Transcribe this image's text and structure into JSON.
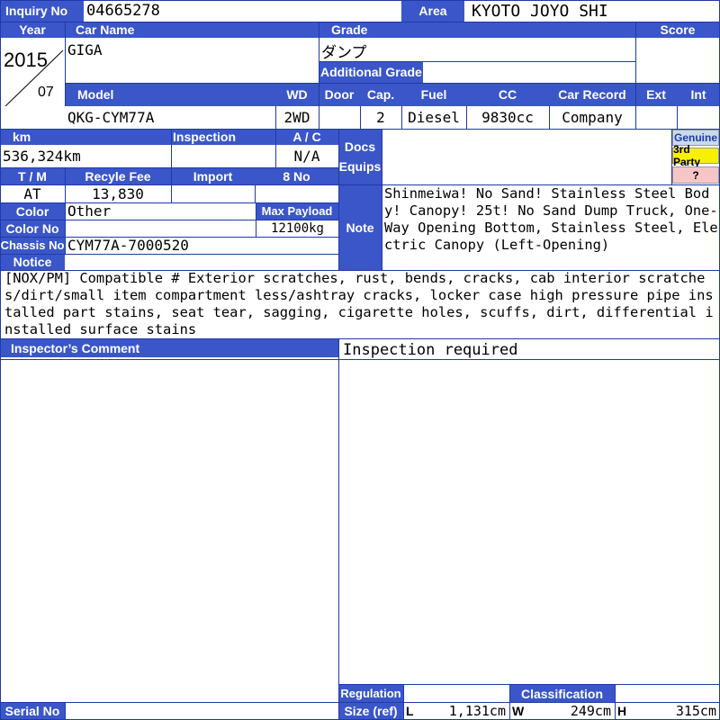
{
  "labels": {
    "inquiry_no": "Inquiry No",
    "area": "Area",
    "year": "Year",
    "car_name": "Car Name",
    "grade": "Grade",
    "score": "Score",
    "additional_grade": "Additional Grade",
    "model": "Model",
    "wd": "WD",
    "door": "Door",
    "cap": "Cap.",
    "fuel": "Fuel",
    "cc": "CC",
    "car_record": "Car Record",
    "ext": "Ext",
    "int": "Int",
    "km": "km",
    "inspection": "Inspection",
    "ac": "A / C",
    "docs": "Docs",
    "equips": "Equips",
    "tm": "T / M",
    "recycle_fee": "Recyle Fee",
    "import": "Import",
    "eight_no": "8 No",
    "color": "Color",
    "max_payload": "Max Payload",
    "color_no": "Color No",
    "note": "Note",
    "chassis_no": "Chassis No",
    "notice": "Notice",
    "inspector_comment": "Inspector’s Comment",
    "regulation": "Regulation",
    "classification": "Classification",
    "size_ref": "Size (ref)",
    "serial_no": "Serial No",
    "l": "L",
    "w": "W",
    "h": "H"
  },
  "values": {
    "inquiry_no": "04665278",
    "area": "KYOTO JOYO SHI",
    "year": "2015",
    "month": "07",
    "car_name": "GIGA",
    "grade": "ダンプ",
    "additional_grade": "",
    "score": "",
    "model": "QKG-CYM77A",
    "wd": "2WD",
    "door": "",
    "cap": "2",
    "fuel": "Diesel",
    "cc": "9830cc",
    "car_record": "Company",
    "ext": "",
    "int": "",
    "km": "536,324km",
    "inspection": "",
    "ac": "N/A",
    "tm": "AT",
    "recycle_fee": "13,830",
    "import": "",
    "eight_no": "",
    "color": "Other",
    "max_payload": "12100kg",
    "color_no": "",
    "chassis_no": "CYM77A-7000520",
    "note": "Shinmeiwa! No Sand! Stainless Steel Body! Canopy! 25t! No Sand Dump Truck, One-Way Opening Bottom, Stainless Steel, Electric Canopy (Left-Opening)",
    "notice": "[NOX/PM] Compatible # Exterior scratches, rust, bends, cracks, cab interior scratches/dirt/small item compartment less/ashtray cracks, locker case high pressure pipe installed part stains, seat tear, sagging, cigarette holes, scuffs, dirt, differential installed surface stains",
    "inspector_comment": "",
    "inspection_status": "Inspection required",
    "regulation": "",
    "classification": "",
    "size_l": "1,131cm",
    "size_w": "249cm",
    "size_h": "315cm",
    "serial_no": ""
  },
  "badges": {
    "genuine": "Genuine",
    "third_party": "3rd Party",
    "unknown": "?"
  },
  "colors": {
    "header": "#3a56c8",
    "genuine_bg": "#c9daf0",
    "third_party_bg": "#f7f000",
    "unknown_bg": "#f6c6c6"
  }
}
